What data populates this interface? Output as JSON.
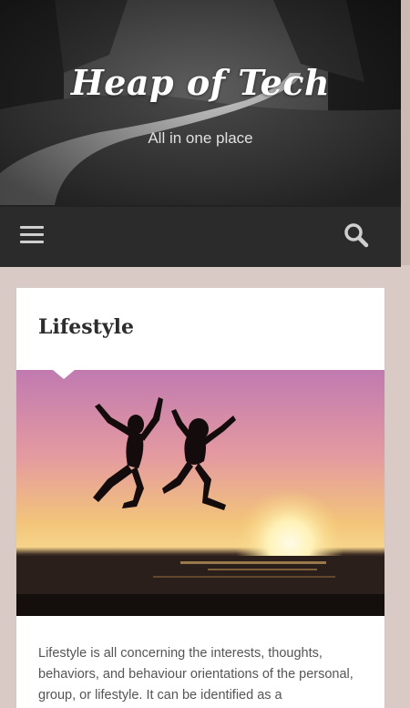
{
  "site": {
    "title": "Heap of Tech",
    "tagline": "All in one place"
  },
  "navbar": {
    "menu_icon": "hamburger-menu-icon",
    "search_icon": "search-icon"
  },
  "post": {
    "title": "Lifestyle",
    "excerpt": "Lifestyle is all concerning the interests, thoughts, behaviors, and behaviour orientations of the personal, group, or lifestyle. It can be identified as a"
  },
  "colors": {
    "page_bg": "#d9cac6",
    "navbar_bg": "#2b2b2b",
    "card_bg": "#ffffff",
    "title_text": "#2d2d2d",
    "body_text": "#555555"
  }
}
